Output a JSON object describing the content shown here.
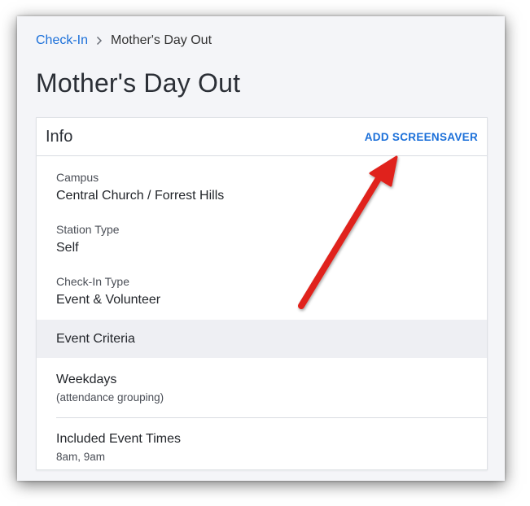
{
  "breadcrumb": {
    "root": "Check-In",
    "current": "Mother's Day Out"
  },
  "page": {
    "title": "Mother's Day Out"
  },
  "info_card": {
    "title": "Info",
    "action_label": "ADD SCREENSAVER",
    "fields": [
      {
        "label": "Campus",
        "value": "Central Church / Forrest Hills"
      },
      {
        "label": "Station Type",
        "value": "Self"
      },
      {
        "label": "Check-In Type",
        "value": "Event & Volunteer"
      }
    ],
    "section": "Event Criteria",
    "items": [
      {
        "title": "Weekdays",
        "subtitle": "(attendance grouping)"
      },
      {
        "title": "Included Event Times",
        "subtitle": "8am, 9am"
      }
    ]
  },
  "colors": {
    "link": "#1a6fd9",
    "annotation_arrow": "#e0241b"
  }
}
